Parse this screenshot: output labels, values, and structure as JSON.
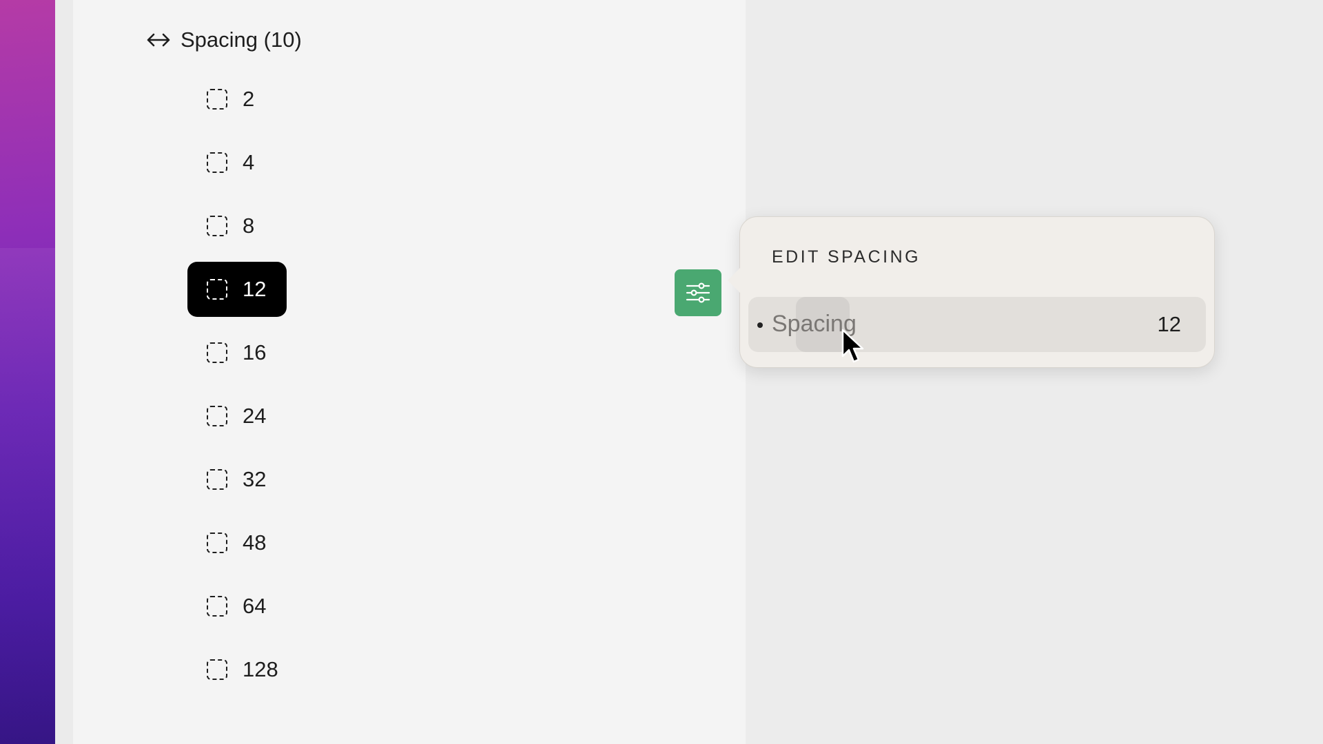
{
  "sidebar": {
    "group_label": "Spacing (10)",
    "group_icon": "left-right-arrows-icon",
    "tokens": [
      {
        "label": "2",
        "selected": false
      },
      {
        "label": "4",
        "selected": false
      },
      {
        "label": "8",
        "selected": false
      },
      {
        "label": "12",
        "selected": true
      },
      {
        "label": "16",
        "selected": false
      },
      {
        "label": "24",
        "selected": false
      },
      {
        "label": "32",
        "selected": false
      },
      {
        "label": "48",
        "selected": false
      },
      {
        "label": "64",
        "selected": false
      },
      {
        "label": "128",
        "selected": false
      }
    ],
    "token_icon": "dashed-square-icon"
  },
  "edit_button": {
    "icon": "sliders-icon",
    "color": "#4aa871"
  },
  "popover": {
    "title": "EDIT SPACING",
    "field": {
      "label": "Spacing",
      "value": "12"
    }
  },
  "colors": {
    "selected_bg": "#000000",
    "accent_green": "#4aa871",
    "popover_bg": "#f1eeea"
  }
}
